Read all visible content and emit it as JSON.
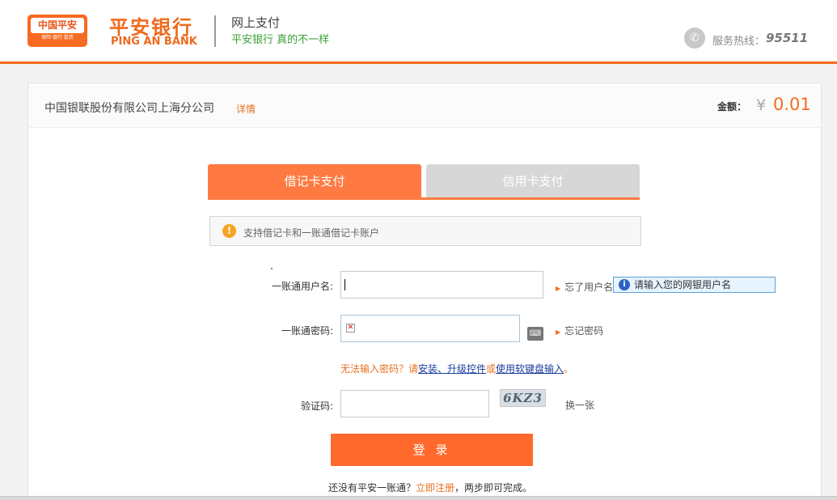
{
  "header": {
    "logo_badge_top": "中国平安",
    "logo_badge_bottom": "保险·银行·投资",
    "bank_name_cn": "平安银行",
    "bank_name_en": "PING AN BANK",
    "title": "网上支付",
    "subtitle": "平安银行 真的不一样",
    "hotline_label": "服务热线：",
    "hotline_number": "95511"
  },
  "merchant": {
    "name": "中国银联股份有限公司上海分公司",
    "detail_link": "详情",
    "amount_label": "金额：",
    "currency_symbol": "¥",
    "amount": "0.01"
  },
  "tabs": [
    {
      "label": "借记卡支付",
      "active": true
    },
    {
      "label": "信用卡支付",
      "active": false
    }
  ],
  "notice": {
    "icon": "!",
    "text": "支持借记卡和一账通借记卡账户"
  },
  "form": {
    "username_label": "一账通用户名:",
    "username_value": "",
    "forgot_username": "忘了用户名",
    "tooltip": "请输入您的网银用户名",
    "password_label": "一账通密码:",
    "forgot_password": "忘记密码",
    "warning_prefix": "无法输入密码？请",
    "warning_link_install": "安装、升级控件",
    "warning_or": "或",
    "warning_link_keyboard": "使用软键盘输入",
    "warning_suffix": "。",
    "captcha_label": "验证码:",
    "captcha_text": "6KZ3",
    "captcha_refresh": "换一张",
    "login_button": "登 录",
    "register_prefix": "还没有平安一账通？",
    "register_link": "立即注册",
    "register_suffix": "，两步即可完成。"
  },
  "colors": {
    "accent": "#f76b1c",
    "tab_active": "#ff7a42",
    "tab_inactive": "#d7d7d7",
    "subtitle_green": "#3aa035"
  }
}
